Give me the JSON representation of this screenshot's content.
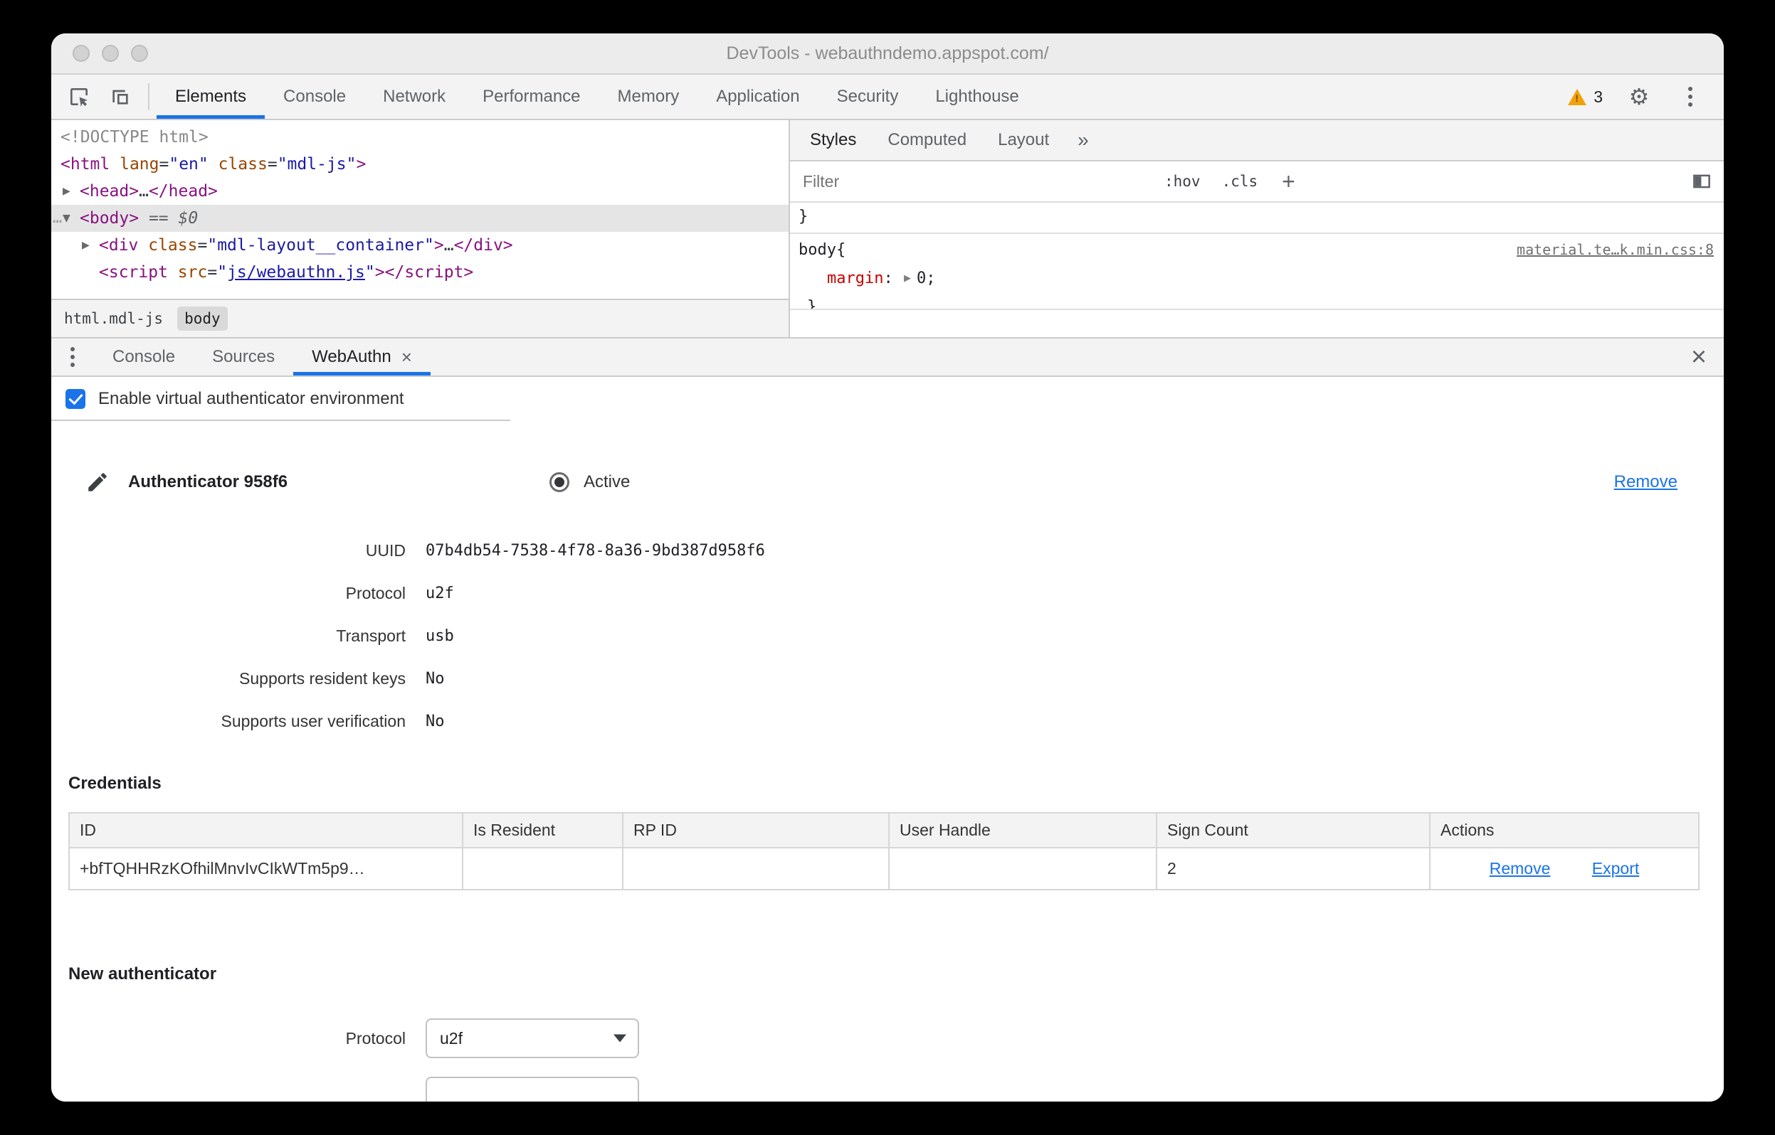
{
  "window": {
    "title": "DevTools - webauthndemo.appspot.com/"
  },
  "toolbar": {
    "tabs": [
      "Elements",
      "Console",
      "Network",
      "Performance",
      "Memory",
      "Application",
      "Security",
      "Lighthouse"
    ],
    "warning_count": "3",
    "gear_symbol": "⚙"
  },
  "elements_panel": {
    "lines": [
      {
        "indent": 0,
        "arrow": null,
        "gutter": null,
        "selected": false,
        "tokens": [
          {
            "c": "doctype",
            "t": "<!DOCTYPE html>"
          }
        ]
      },
      {
        "indent": 0,
        "arrow": null,
        "gutter": null,
        "selected": false,
        "tokens": [
          {
            "c": "tag",
            "t": "<html"
          },
          {
            "c": "attr",
            "t": " lang"
          },
          {
            "c": "plain",
            "t": "="
          },
          {
            "c": "val",
            "t": "\"en\""
          },
          {
            "c": "attr",
            "t": " class"
          },
          {
            "c": "plain",
            "t": "="
          },
          {
            "c": "val",
            "t": "\"mdl-js\""
          },
          {
            "c": "tag",
            "t": ">"
          }
        ]
      },
      {
        "indent": 1,
        "arrow": "right",
        "gutter": null,
        "selected": false,
        "tokens": [
          {
            "c": "tag",
            "t": "<head>"
          },
          {
            "c": "plain",
            "t": "…"
          },
          {
            "c": "tag",
            "t": "</head>"
          }
        ]
      },
      {
        "indent": 1,
        "arrow": "down",
        "gutter": "…",
        "selected": true,
        "tokens": [
          {
            "c": "tag",
            "t": "<body>"
          },
          {
            "c": "eq",
            "t": " == "
          },
          {
            "c": "dollar",
            "t": "$0"
          }
        ]
      },
      {
        "indent": 2,
        "arrow": "right",
        "gutter": null,
        "selected": false,
        "tokens": [
          {
            "c": "tag",
            "t": "<div"
          },
          {
            "c": "attr",
            "t": " class"
          },
          {
            "c": "plain",
            "t": "="
          },
          {
            "c": "val",
            "t": "\"mdl-layout__container\""
          },
          {
            "c": "tag",
            "t": ">"
          },
          {
            "c": "plain",
            "t": "…"
          },
          {
            "c": "tag",
            "t": "</div>"
          }
        ]
      },
      {
        "indent": 2,
        "arrow": null,
        "gutter": null,
        "selected": false,
        "tokens": [
          {
            "c": "tag",
            "t": "<script"
          },
          {
            "c": "attr",
            "t": " src"
          },
          {
            "c": "plain",
            "t": "="
          },
          {
            "c": "val",
            "t": "\""
          },
          {
            "c": "val-link",
            "t": "js/webauthn.js"
          },
          {
            "c": "val",
            "t": "\""
          },
          {
            "c": "tag",
            "t": ">"
          },
          {
            "c": "tag",
            "t": "</script>"
          }
        ]
      }
    ],
    "breadcrumbs": [
      {
        "label": "html.mdl-js"
      },
      {
        "label": "body"
      }
    ]
  },
  "styles_panel": {
    "tabs": [
      "Styles",
      "Computed",
      "Layout"
    ],
    "more_symbol": "»",
    "filter_placeholder": "Filter",
    "pseudo_toggle": ":hov",
    "class_toggle": ".cls",
    "add_symbol": "+",
    "rules": {
      "prev_close": "}",
      "selector": "body",
      "open_brace": " {",
      "source_link": "material.te…k.min.css:8",
      "property": "margin",
      "colon": ": ",
      "value": "0",
      "semicolon": ";",
      "close": "}"
    }
  },
  "drawer": {
    "tabs": [
      "Console",
      "Sources",
      "WebAuthn"
    ],
    "tab_close_symbol": "×",
    "close_symbol": "×",
    "checkbox_label": "Enable virtual authenticator environment",
    "authenticator": {
      "title": "Authenticator 958f6",
      "status_label": "Active",
      "remove_label": "Remove",
      "fields": [
        {
          "label": "UUID",
          "value": "07b4db54-7538-4f78-8a36-9bd387d958f6"
        },
        {
          "label": "Protocol",
          "value": "u2f"
        },
        {
          "label": "Transport",
          "value": "usb"
        },
        {
          "label": "Supports resident keys",
          "value": "No"
        },
        {
          "label": "Supports user verification",
          "value": "No"
        }
      ]
    },
    "credentials": {
      "title": "Credentials",
      "columns": [
        "ID",
        "Is Resident",
        "RP ID",
        "User Handle",
        "Sign Count",
        "Actions"
      ],
      "row": {
        "id": "+bfTQHHRzKOfhilMnvIvCIkWTm5p9…",
        "is_resident": "",
        "rp_id": "",
        "user_handle": "",
        "sign_count": "2",
        "remove_label": "Remove",
        "export_label": "Export"
      }
    },
    "new_authenticator": {
      "title": "New authenticator",
      "protocol_label": "Protocol",
      "protocol_value": "u2f"
    }
  }
}
